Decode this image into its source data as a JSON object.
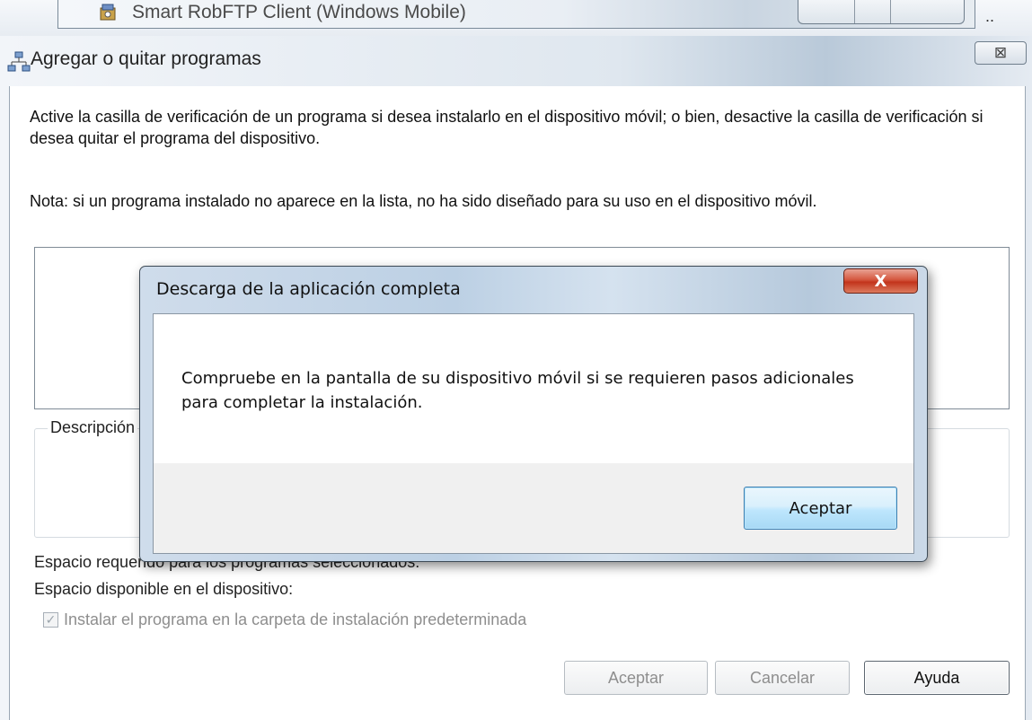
{
  "background_window": {
    "title": "Smart RobFTP Client (Windows Mobile)",
    "more": ".."
  },
  "main_dialog": {
    "title": "Agregar o quitar programas",
    "close_glyph": "⊠",
    "intro": "Active la casilla de verificación de un programa si desea instalarlo en el dispositivo móvil; o bien, desactive la casilla de verificación si desea quitar el programa del dispositivo.",
    "note": "Nota: si un programa instalado no aparece en la lista, no ha sido diseñado para su uso en el dispositivo móvil.",
    "description_label": "Descripción",
    "space_required_label": "Espacio requerido para los programas seleccionados:",
    "space_available_label": "Espacio disponible en el dispositivo:",
    "install_default_label": "Instalar el programa en la carpeta de instalación predeterminada",
    "install_default_checked": true,
    "buttons": {
      "ok": "Aceptar",
      "cancel": "Cancelar",
      "help": "Ayuda"
    }
  },
  "modal": {
    "title": "Descarga de la aplicación completa",
    "close_glyph": "X",
    "message": "Compruebe en la pantalla de su dispositivo móvil si se requieren pasos adicionales para completar la instalación.",
    "ok_label": "Aceptar"
  },
  "icons": {
    "app_icon": "program-icon",
    "dialog_icon": "network-icon"
  }
}
